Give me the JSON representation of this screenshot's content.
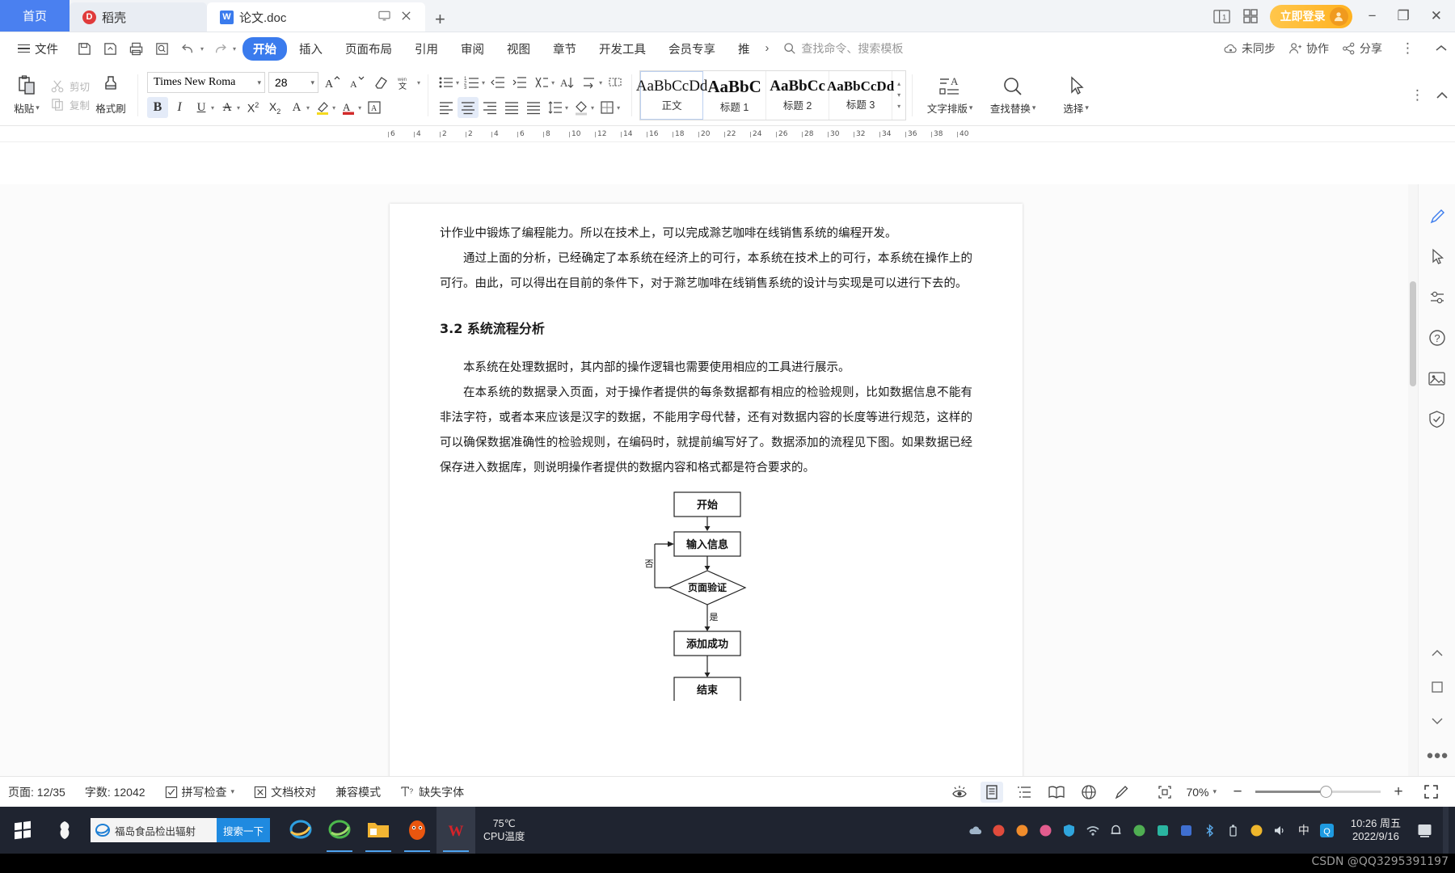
{
  "titlebar": {
    "tabs": [
      {
        "label": "首页",
        "name": "tab-home"
      },
      {
        "label": "稻壳",
        "name": "tab-docer",
        "icon": "docer-icon"
      },
      {
        "label": "论文.doc",
        "name": "tab-document",
        "icon": "wps-writer-icon"
      }
    ],
    "new_tab_label": "+",
    "right": {
      "page_count_icon": "one-page-view-icon",
      "grid_icon": "tab-grid-icon",
      "login_label": "立即登录",
      "minimize": "−",
      "maximize": "❐",
      "close": "✕"
    }
  },
  "menubar": {
    "file_label": "文件",
    "quick_access": [
      "save-icon",
      "save-as-icon",
      "print-icon",
      "print-preview-icon",
      "undo-icon",
      "redo-icon",
      "customize-qat-icon"
    ],
    "items": [
      {
        "label": "开始",
        "active": true
      },
      {
        "label": "插入",
        "active": false
      },
      {
        "label": "页面布局",
        "active": false
      },
      {
        "label": "引用",
        "active": false
      },
      {
        "label": "审阅",
        "active": false
      },
      {
        "label": "视图",
        "active": false
      },
      {
        "label": "章节",
        "active": false
      },
      {
        "label": "开发工具",
        "active": false
      },
      {
        "label": "会员专享",
        "active": false
      },
      {
        "label": "推",
        "active": false
      }
    ],
    "more_arrow": "›",
    "search_placeholder": "查找命令、搜索模板",
    "right_items": [
      {
        "label": "未同步",
        "icon": "cloud-sync-icon"
      },
      {
        "label": "协作",
        "icon": "collaborate-icon"
      },
      {
        "label": "分享",
        "icon": "share-icon"
      }
    ],
    "collapse_ribbon_icon": "chevron-up-icon"
  },
  "ribbon": {
    "paste_label": "粘贴",
    "cut_label": "剪切",
    "copy_label": "复制",
    "format_painter_label": "格式刷",
    "font_name": "Times New Roma",
    "font_size": "28",
    "styles": [
      {
        "preview": "AaBbCcDd",
        "label": "正文",
        "selected": true
      },
      {
        "preview": "AaBbC",
        "label": "标题 1",
        "selected": false
      },
      {
        "preview": "AaBbCc",
        "label": "标题 2",
        "selected": false
      },
      {
        "preview": "AaBbCcDd",
        "label": "标题 3",
        "selected": false
      }
    ],
    "right_tools": [
      {
        "label": "文字排版",
        "icon": "text-layout-icon"
      },
      {
        "label": "查找替换",
        "icon": "find-replace-icon"
      },
      {
        "label": "选择",
        "icon": "select-arrow-icon"
      }
    ]
  },
  "ruler": {
    "left_marks": [
      "6",
      "4",
      "2"
    ],
    "marks": [
      "2",
      "4",
      "6",
      "8",
      "10",
      "12",
      "14",
      "16",
      "18",
      "20",
      "22",
      "24",
      "26",
      "28",
      "30",
      "32",
      "34",
      "36",
      "38",
      "40"
    ]
  },
  "document": {
    "paragraphs": [
      "计作业中锻炼了编程能力。所以在技术上，可以完成滁艺咖啡在线销售系统的编程开发。",
      "通过上面的分析，已经确定了本系统在经济上的可行，本系统在技术上的可行，本系统在操作上的可行。由此，可以得出在目前的条件下，对于滁艺咖啡在线销售系统的设计与实现是可以进行下去的。"
    ],
    "section_heading": "3.2 系统流程分析",
    "paragraphs2": [
      "本系统在处理数据时，其内部的操作逻辑也需要使用相应的工具进行展示。",
      "在本系统的数据录入页面，对于操作者提供的每条数据都有相应的检验规则，比如数据信息不能有非法字符，或者本来应该是汉字的数据，不能用字母代替，还有对数据内容的长度等进行规范，这样的可以确保数据准确性的检验规则，在编码时，就提前编写好了。数据添加的流程见下图。如果数据已经保存进入数据库，则说明操作者提供的数据内容和格式都是符合要求的。"
    ],
    "flowchart": {
      "start": "开始",
      "input": "输入信息",
      "decision": "页面验证",
      "no_label": "否",
      "yes_label": "是",
      "success": "添加成功",
      "end": "结束"
    }
  },
  "statusbar": {
    "page_label": "页面: 12/35",
    "word_count_label": "字数: 12042",
    "spellcheck_label": "拼写检查",
    "proofread_label": "文档校对",
    "compat_label": "兼容模式",
    "missing_font_label": "缺失字体",
    "views": [
      "eye-protect-icon",
      "print-layout-icon",
      "outline-icon",
      "reading-layout-icon",
      "web-layout-icon",
      "annotation-icon"
    ],
    "fit_icon": "fit-page-icon",
    "zoom_level": "70%",
    "zoom_out": "−",
    "zoom_in": "+",
    "fullscreen_icon": "fullscreen-icon"
  },
  "taskbar": {
    "start_icon": "windows-start-icon",
    "pinned_icon": "app-icon",
    "search_value": "福岛食品检出辐射",
    "search_button": "搜索一下",
    "apps": [
      "internet-explorer-icon",
      "browser-360-icon",
      "file-explorer-icon",
      "sogou-icon",
      "wps-writer-icon"
    ],
    "cpu_temp_value": "75℃",
    "cpu_temp_label": "CPU温度",
    "tray_icons": [
      "cloud-icon",
      "network-icon",
      "shield-icon",
      "volume-icon",
      "battery-icon",
      "bluetooth-icon",
      "usb-icon",
      "notifications-icon",
      "ime-icon",
      "qq-icon"
    ],
    "ime_label": "中",
    "clock_time": "10:26 周五",
    "clock_date": "2022/9/16"
  },
  "watermark": "CSDN @QQ3295391197"
}
